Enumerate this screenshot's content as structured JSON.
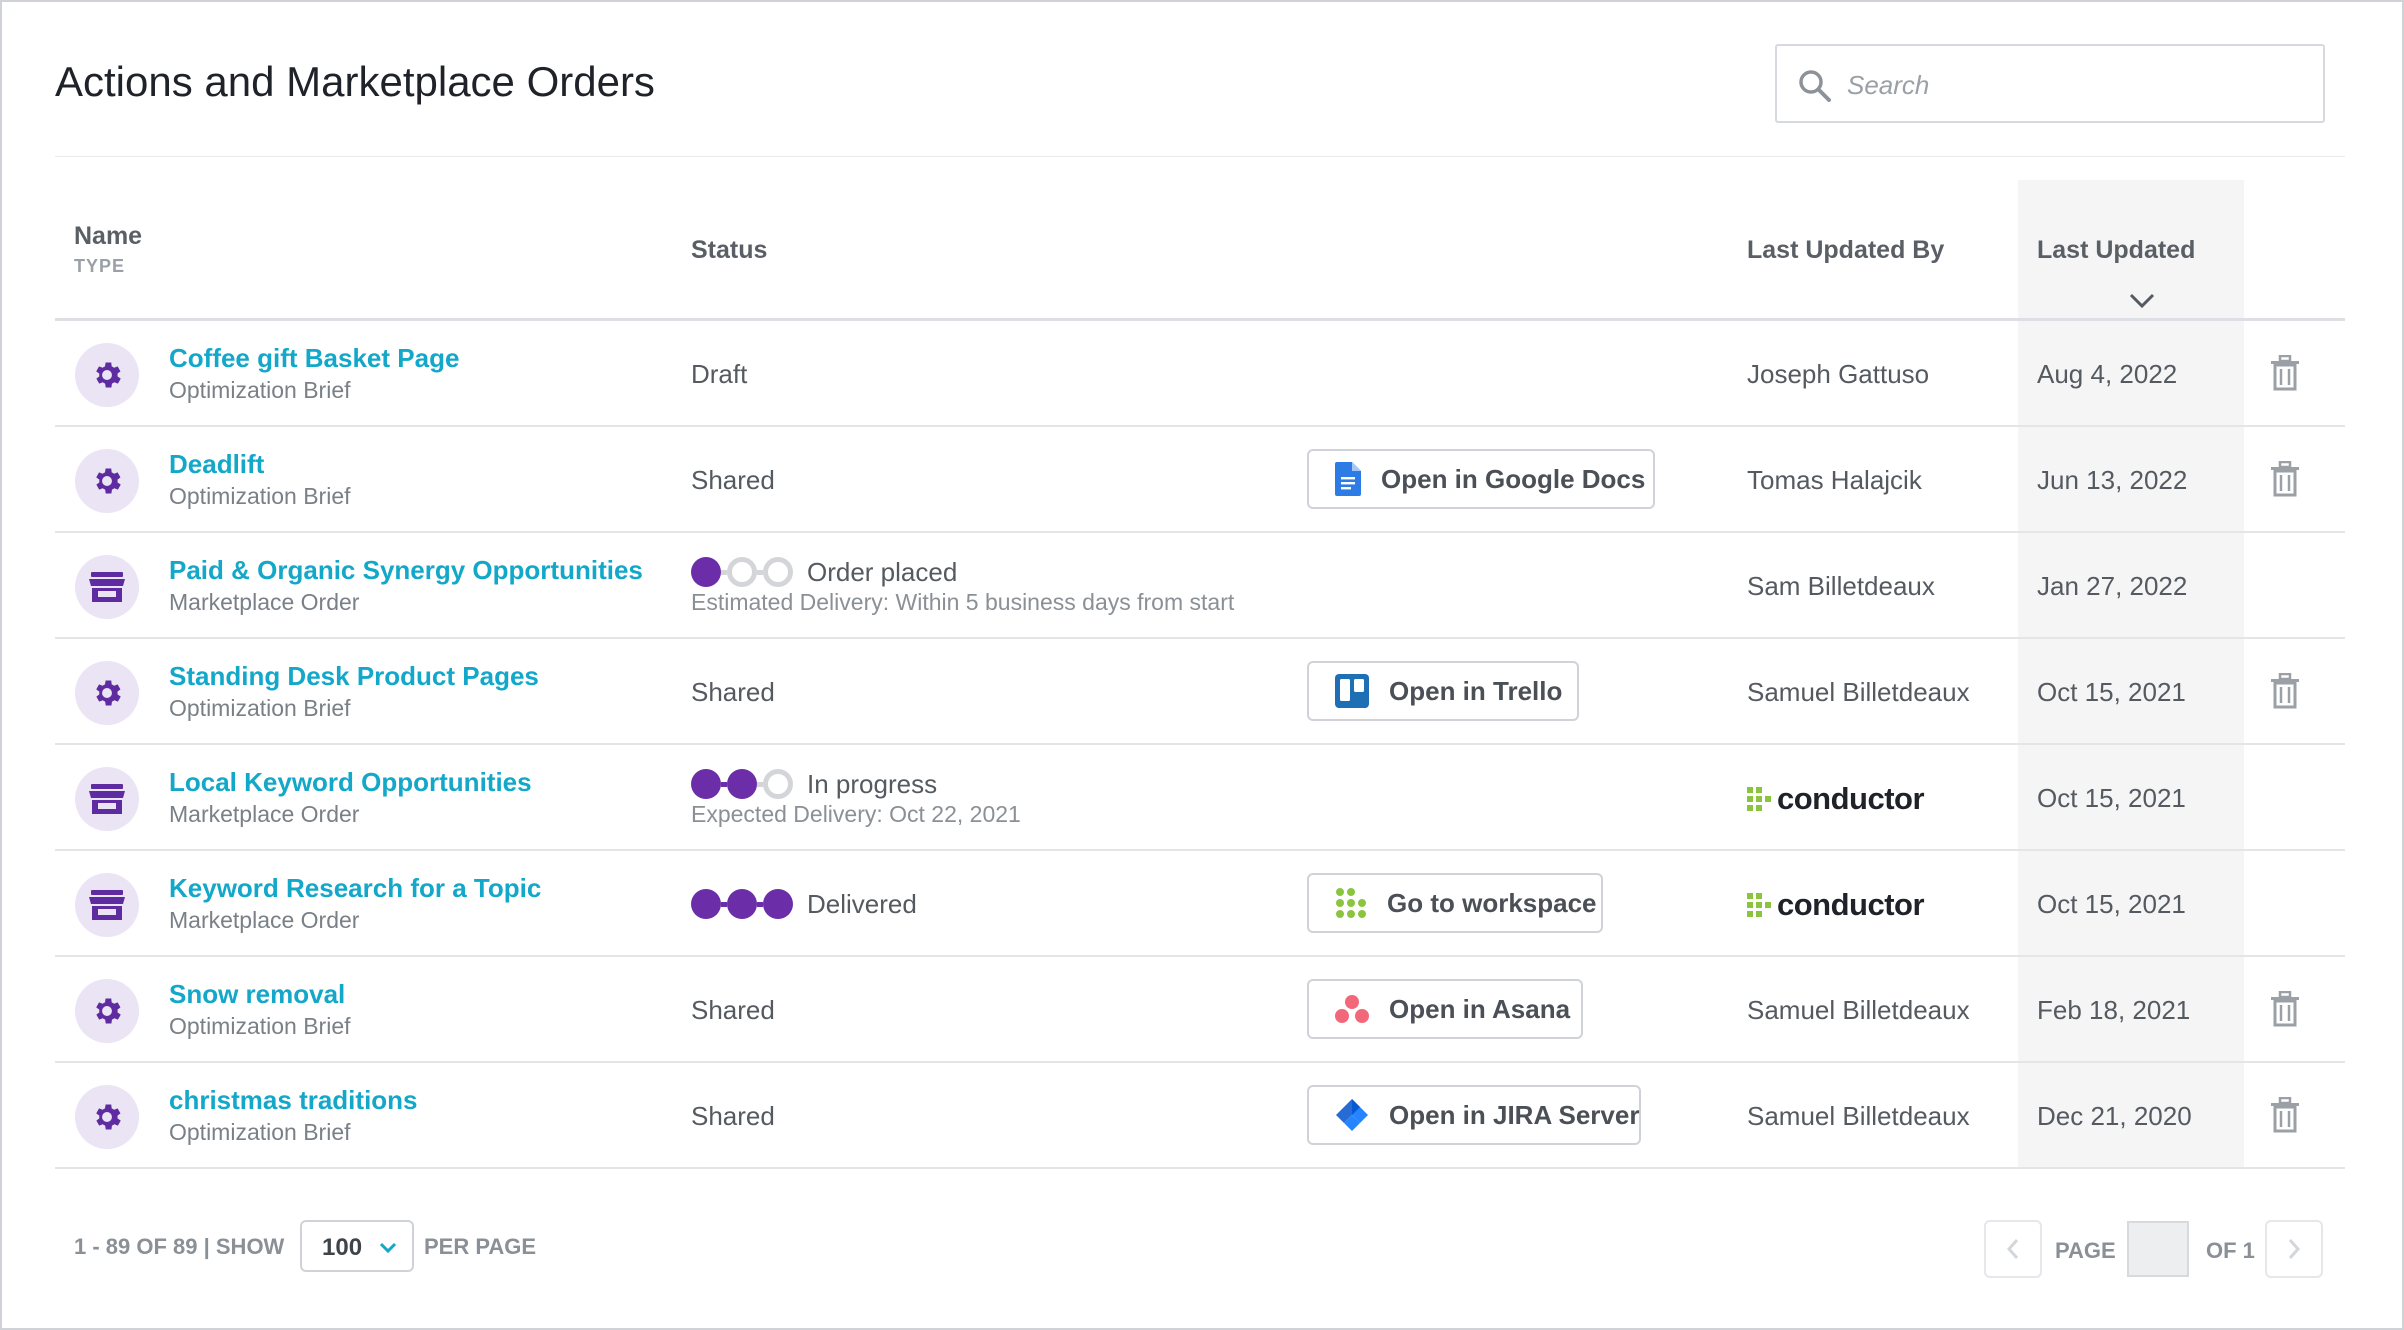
{
  "page": {
    "title": "Actions and Marketplace Orders"
  },
  "search": {
    "placeholder": "Search",
    "value": ""
  },
  "table": {
    "headers": {
      "name": "Name",
      "type": "TYPE",
      "status": "Status",
      "last_updated_by": "Last Updated By",
      "last_updated": "Last Updated"
    },
    "sort": {
      "column": "Last Updated",
      "direction": "descending"
    },
    "rows": [
      {
        "name": "Coffee gift Basket Page",
        "type": "Optimization Brief",
        "icon": "gear-icon",
        "status": "Draft",
        "updated_by": "Joseph Gattuso",
        "updated": "Aug 4, 2022",
        "deletable": true
      },
      {
        "name": "Deadlift",
        "type": "Optimization Brief",
        "icon": "gear-icon",
        "status": "Shared",
        "action": {
          "label": "Open in Google Docs",
          "icon": "google-docs-icon"
        },
        "updated_by": "Tomas Halajcik",
        "updated": "Jun 13, 2022",
        "deletable": true
      },
      {
        "name": "Paid & Organic Synergy Opportunities",
        "type": "Marketplace Order",
        "icon": "store-icon",
        "status": "Order placed",
        "progress_steps": 1,
        "status_detail": "Estimated Delivery: Within 5 business days from start",
        "updated_by": "Sam Billetdeaux",
        "updated": "Jan 27, 2022",
        "deletable": false
      },
      {
        "name": "Standing Desk Product Pages",
        "type": "Optimization Brief",
        "icon": "gear-icon",
        "status": "Shared",
        "action": {
          "label": "Open in Trello",
          "icon": "trello-icon"
        },
        "updated_by": "Samuel Billetdeaux",
        "updated": "Oct 15, 2021",
        "deletable": true
      },
      {
        "name": "Local Keyword Opportunities",
        "type": "Marketplace Order",
        "icon": "store-icon",
        "status": "In progress",
        "progress_steps": 2,
        "status_detail": "Expected Delivery: Oct 22, 2021",
        "updated_by_logo": "conductor",
        "updated": "Oct 15, 2021",
        "deletable": false
      },
      {
        "name": "Keyword Research for a Topic",
        "type": "Marketplace Order",
        "icon": "store-icon",
        "status": "Delivered",
        "progress_steps": 3,
        "action": {
          "label": "Go to workspace",
          "icon": "conductor-grid-icon"
        },
        "updated_by_logo": "conductor",
        "updated": "Oct 15, 2021",
        "deletable": false
      },
      {
        "name": "Snow removal",
        "type": "Optimization Brief",
        "icon": "gear-icon",
        "status": "Shared",
        "action": {
          "label": "Open in Asana",
          "icon": "asana-icon"
        },
        "updated_by": "Samuel Billetdeaux",
        "updated": "Feb 18, 2021",
        "deletable": true
      },
      {
        "name": "christmas traditions",
        "type": "Optimization Brief",
        "icon": "gear-icon",
        "status": "Shared",
        "action": {
          "label": "Open in JIRA Server",
          "icon": "jira-icon"
        },
        "updated_by": "Samuel Billetdeaux",
        "updated": "Dec 21, 2020",
        "deletable": true
      }
    ]
  },
  "pagination": {
    "range": "1 - 89 OF 89 | SHOW",
    "per_page": "100",
    "per_page_label": "PER PAGE",
    "page_label": "PAGE",
    "current_page": "",
    "of_label": "OF 1"
  },
  "colors": {
    "accent_purple": "#6c2ea8",
    "link_cyan": "#13a8c9",
    "icon_circle_bg": "#ebe4f4",
    "sorted_column_bg": "#f5f5f6"
  }
}
